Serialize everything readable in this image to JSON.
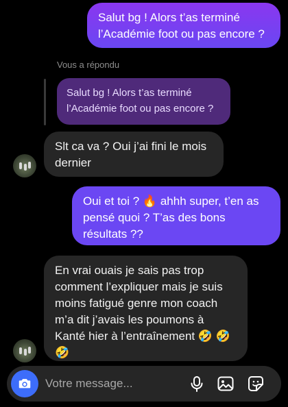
{
  "messages": [
    {
      "id": "m1",
      "from": "me",
      "text": "Salut bg ! Alors t’as terminé l’Académie foot ou pas encore ?"
    },
    {
      "id": "m2",
      "from": "them",
      "text": "Slt ca va ? Oui j’ai fini le mois dernier",
      "replied_label": "Vous a répondu",
      "reply_to": "Salut bg ! Alors t’as terminé l’Académie foot ou pas encore ?"
    },
    {
      "id": "m3",
      "from": "me",
      "text": "Oui et toi ? 🔥 ahhh super, t’en as pensé quoi ? T’as des bons résultats ??"
    },
    {
      "id": "m4",
      "from": "them",
      "text": "En vrai ouais je sais pas trop comment l’expliquer mais je suis moins fatigué genre mon coach m’a dit j’avais les poumons à Kanté hier à l’entraînement 🤣 🤣 🤣"
    }
  ],
  "composer": {
    "placeholder": "Votre message..."
  },
  "icons": [
    "camera-icon",
    "microphone-icon",
    "gallery-icon",
    "sticker-icon"
  ],
  "colors": {
    "background": "#000000",
    "outgoing_bubble": "#7d3ff2",
    "incoming_bubble": "#262626",
    "reply_bubble": "#4f2a7a",
    "camera_button": "#3d6dfa"
  }
}
